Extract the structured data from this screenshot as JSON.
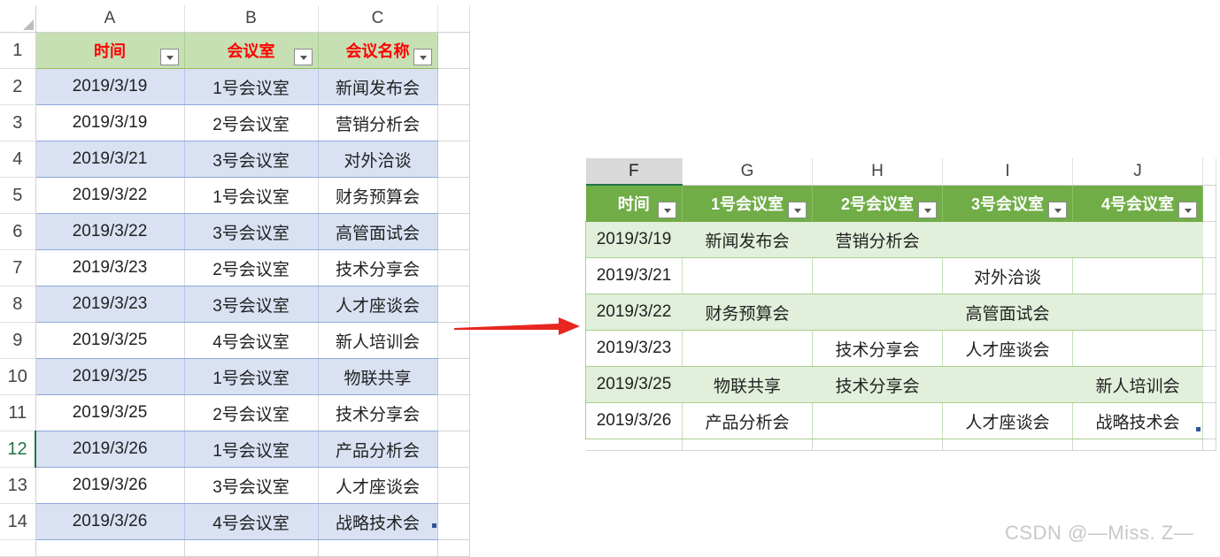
{
  "left_sheet": {
    "columns": [
      "A",
      "B",
      "C"
    ],
    "row_numbers": [
      "1",
      "2",
      "3",
      "4",
      "5",
      "6",
      "7",
      "8",
      "9",
      "10",
      "11",
      "12",
      "13",
      "14"
    ],
    "selected_row": "12",
    "headers": [
      "时间",
      "会议室",
      "会议名称"
    ],
    "rows": [
      [
        "2019/3/19",
        "1号会议室",
        "新闻发布会"
      ],
      [
        "2019/3/19",
        "2号会议室",
        "营销分析会"
      ],
      [
        "2019/3/21",
        "3号会议室",
        "对外洽谈"
      ],
      [
        "2019/3/22",
        "1号会议室",
        "财务预算会"
      ],
      [
        "2019/3/22",
        "3号会议室",
        "高管面试会"
      ],
      [
        "2019/3/23",
        "2号会议室",
        "技术分享会"
      ],
      [
        "2019/3/23",
        "3号会议室",
        "人才座谈会"
      ],
      [
        "2019/3/25",
        "4号会议室",
        "新人培训会"
      ],
      [
        "2019/3/25",
        "1号会议室",
        "物联共享"
      ],
      [
        "2019/3/25",
        "2号会议室",
        "技术分享会"
      ],
      [
        "2019/3/26",
        "1号会议室",
        "产品分析会"
      ],
      [
        "2019/3/26",
        "3号会议室",
        "人才座谈会"
      ],
      [
        "2019/3/26",
        "4号会议室",
        "战略技术会"
      ]
    ]
  },
  "right_sheet": {
    "columns": [
      "F",
      "G",
      "H",
      "I",
      "J"
    ],
    "selected_column": "F",
    "headers": [
      "时间",
      "1号会议室",
      "2号会议室",
      "3号会议室",
      "4号会议室"
    ],
    "rows": [
      [
        "2019/3/19",
        "新闻发布会",
        "营销分析会",
        "",
        ""
      ],
      [
        "2019/3/21",
        "",
        "",
        "对外洽谈",
        ""
      ],
      [
        "2019/3/22",
        "财务预算会",
        "",
        "高管面试会",
        ""
      ],
      [
        "2019/3/23",
        "",
        "技术分享会",
        "人才座谈会",
        ""
      ],
      [
        "2019/3/25",
        "物联共享",
        "技术分享会",
        "",
        "新人培训会"
      ],
      [
        "2019/3/26",
        "产品分析会",
        "",
        "人才座谈会",
        "战略技术会"
      ]
    ]
  },
  "arrow_color": "#e8251e",
  "watermark": "CSDN @—Miss. Z—"
}
